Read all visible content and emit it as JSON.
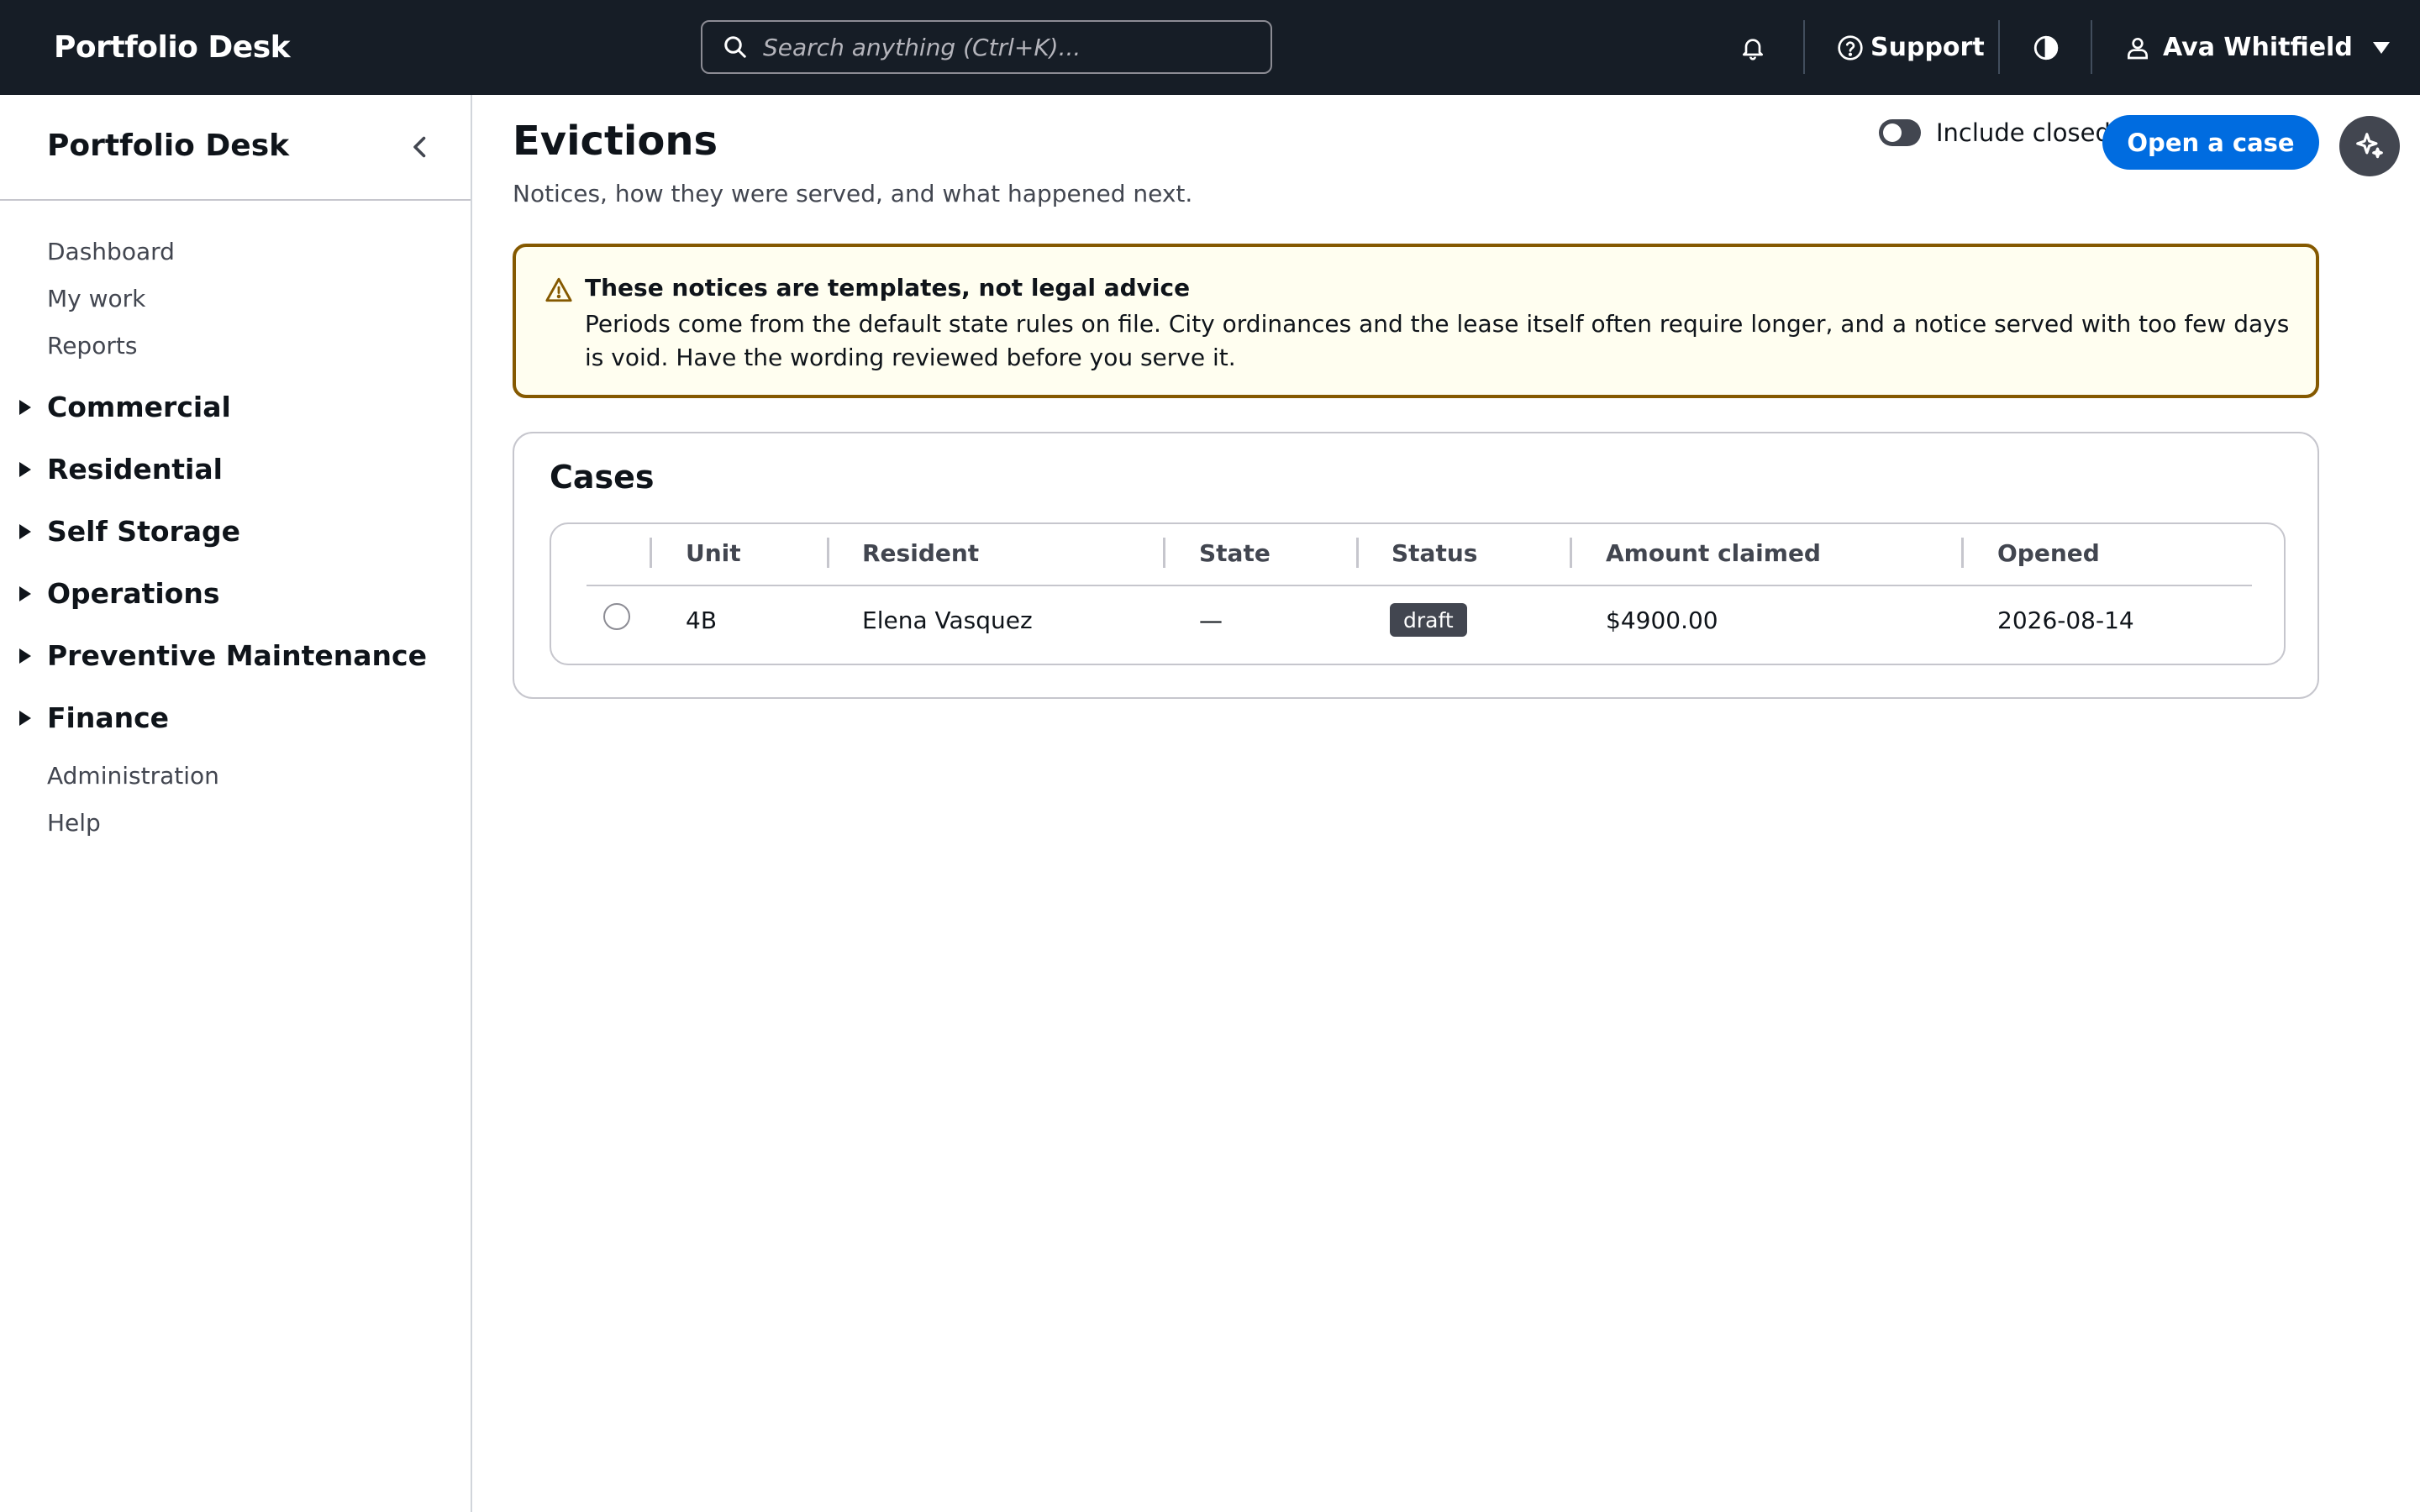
{
  "app": {
    "title": "Portfolio Desk"
  },
  "search": {
    "placeholder": "Search anything (Ctrl+K)..."
  },
  "topbar": {
    "support_label": "Support",
    "user_name": "Ava Whitfield"
  },
  "sidebar": {
    "title": "Portfolio Desk",
    "links_top": [
      "Dashboard",
      "My work",
      "Reports"
    ],
    "groups": [
      "Commercial",
      "Residential",
      "Self Storage",
      "Operations",
      "Preventive Maintenance",
      "Finance"
    ],
    "links_bottom": [
      "Administration",
      "Help"
    ]
  },
  "page": {
    "title": "Evictions",
    "subtitle": "Notices, how they were served, and what happened next.",
    "include_closed_label": "Include closed",
    "include_closed": false,
    "primary_action": "Open a case"
  },
  "alert": {
    "title": "These notices are templates, not legal advice",
    "body": "Periods come from the default state rules on file. City ordinances and the lease itself often require longer, and a notice served with too few days is void. Have the wording reviewed before you serve it."
  },
  "cases": {
    "title": "Cases",
    "columns": [
      "Unit",
      "Resident",
      "State",
      "Status",
      "Amount claimed",
      "Opened"
    ],
    "rows": [
      {
        "unit": "4B",
        "resident": "Elena Vasquez",
        "state": "—",
        "status": "draft",
        "amount": "$4900.00",
        "opened": "2026-08-14"
      }
    ]
  },
  "colors": {
    "topbar": "#161d26",
    "primary": "#006ce0",
    "warning_border": "#855900",
    "warning_bg": "#fffef0"
  }
}
